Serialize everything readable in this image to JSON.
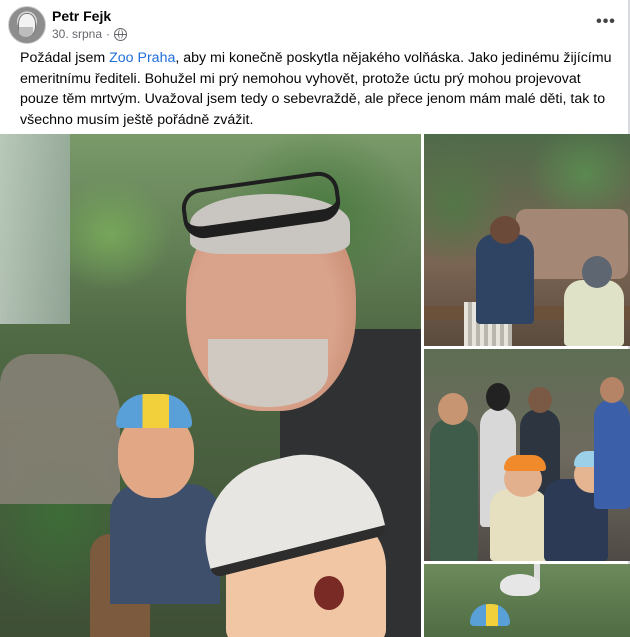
{
  "post": {
    "author": "Petr Fejk",
    "date": "30. srpna",
    "dot": "·",
    "privacy_icon": "globe-icon",
    "more_icon": "more-options-icon",
    "more_label": "•••",
    "text_before_link": "Požádal jsem ",
    "link": "Zoo Praha",
    "text_after_link": ", aby mi konečně poskytla nějakého volňáska. Jako jedinému žijícímu emeritnímu řediteli. Bohužel mi prý nemohou vyhovět, protože úctu prý mohou projevovat pouze těm mrtvým. Uvažoval jsem tedy o sebevraždě, ale přece jenom mám malé děti, tak to všechno musím ještě pořádně zvážit."
  },
  "colors": {
    "link": "#216fdb",
    "meta": "#65676b",
    "text": "#050505"
  }
}
